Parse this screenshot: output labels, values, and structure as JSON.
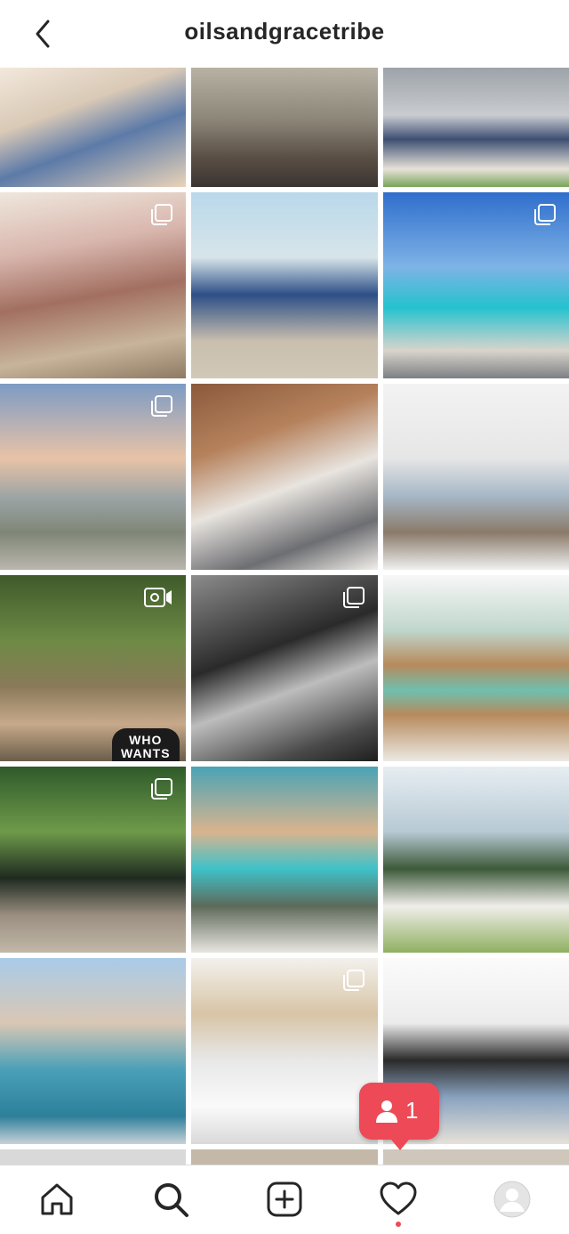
{
  "header": {
    "title": "oilsandgracetribe"
  },
  "grid": {
    "tiles": [
      {
        "id": "post-1",
        "badge": "none",
        "caption": ""
      },
      {
        "id": "post-2",
        "badge": "none",
        "caption": ""
      },
      {
        "id": "post-3",
        "badge": "none",
        "caption": ""
      },
      {
        "id": "post-4",
        "badge": "carousel",
        "caption": ""
      },
      {
        "id": "post-5",
        "badge": "none",
        "caption": ""
      },
      {
        "id": "post-6",
        "badge": "carousel",
        "caption": ""
      },
      {
        "id": "post-7",
        "badge": "carousel",
        "caption": ""
      },
      {
        "id": "post-8",
        "badge": "none",
        "caption": ""
      },
      {
        "id": "post-9",
        "badge": "none",
        "caption": ""
      },
      {
        "id": "post-10",
        "badge": "igtv",
        "caption": "WHO WANTS"
      },
      {
        "id": "post-11",
        "badge": "carousel",
        "caption": ""
      },
      {
        "id": "post-12",
        "badge": "none",
        "caption": ""
      },
      {
        "id": "post-13",
        "badge": "carousel",
        "caption": ""
      },
      {
        "id": "post-14",
        "badge": "none",
        "caption": ""
      },
      {
        "id": "post-15",
        "badge": "none",
        "caption": ""
      },
      {
        "id": "post-16",
        "badge": "none",
        "caption": ""
      },
      {
        "id": "post-17",
        "badge": "carousel",
        "caption": ""
      },
      {
        "id": "post-18",
        "badge": "none",
        "caption": ""
      }
    ]
  },
  "notification": {
    "icon": "person-icon",
    "count": "1",
    "color": "#ed4956"
  },
  "tabbar": {
    "items": [
      "home-icon",
      "search-icon",
      "new-post-icon",
      "activity-heart-icon",
      "profile-avatar"
    ],
    "active": "search-icon"
  },
  "colors": {
    "accent": "#ed4956",
    "border": "#dbdbdb"
  }
}
